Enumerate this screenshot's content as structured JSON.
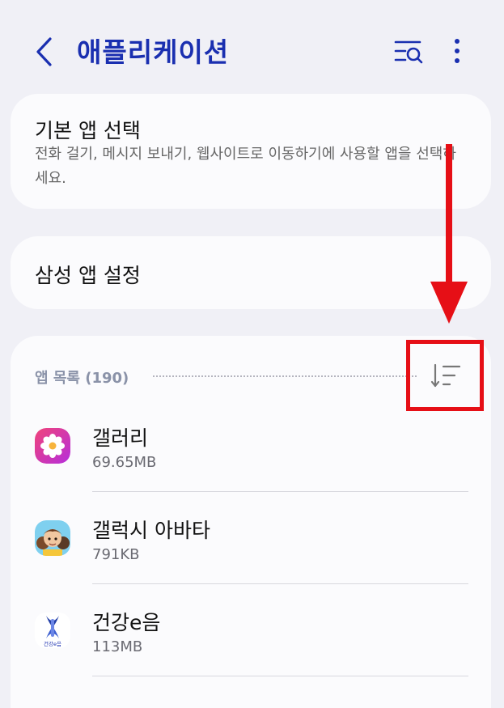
{
  "header": {
    "title": "애플리케이션",
    "back_icon": "chevron-left-icon",
    "search_icon": "list-search-icon",
    "more_icon": "more-vertical-icon"
  },
  "default_apps": {
    "title": "기본 앱 선택",
    "subtitle": "전화 걸기, 메시지 보내기, 웹사이트로 이동하기에 사용할 앱을 선택하세요."
  },
  "samsung_settings": {
    "title": "삼성 앱 설정"
  },
  "app_list": {
    "header": "앱 목록 (190)",
    "sort_icon": "sort-icon",
    "items": [
      {
        "name": "갤러리",
        "size": "69.65MB",
        "icon": "gallery-flower-icon"
      },
      {
        "name": "갤럭시 아바타",
        "size": "791KB",
        "icon": "avatar-icon"
      },
      {
        "name": "건강e음",
        "size": "113MB",
        "icon": "health-e-icon",
        "icon_text": "건강e음"
      }
    ]
  },
  "annotation": {
    "color": "#e60f16"
  },
  "colors": {
    "accent": "#1a2fb0",
    "background": "#f0f0f6",
    "card": "#fbfbfd"
  }
}
